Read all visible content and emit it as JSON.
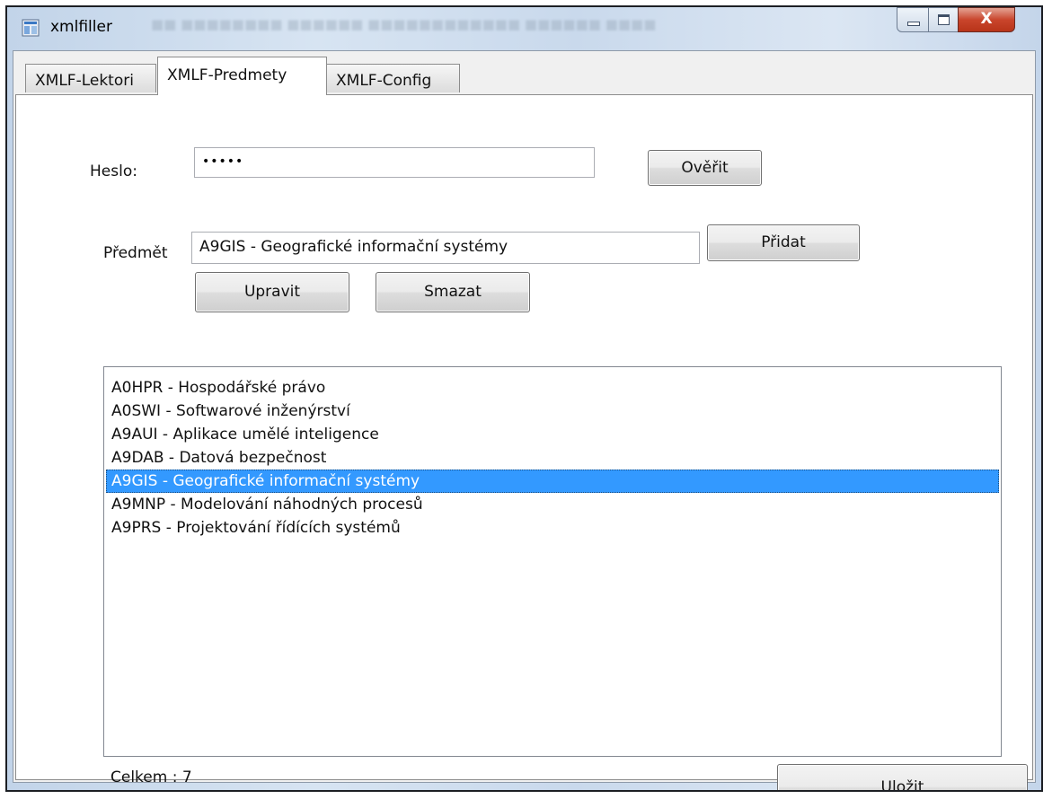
{
  "window": {
    "title": "xmlfiller",
    "background_colors": [
      "#c2d4e9",
      "#dbe6f3"
    ]
  },
  "title_controls": {
    "minimize_icon": "minimize-icon",
    "maximize_icon": "maximize-icon",
    "close_glyph": "X"
  },
  "tabs": [
    {
      "label": "XMLF-Lektori",
      "active": false
    },
    {
      "label": "XMLF-Predmety",
      "active": true
    },
    {
      "label": "XMLF-Config",
      "active": false
    }
  ],
  "form": {
    "password_label": "Heslo:",
    "password_value": "•••••",
    "verify_button": "Ověřit",
    "subject_label": "Předmět",
    "subject_value": "A9GIS - Geografické informační systémy",
    "add_button": "Přidat",
    "edit_button": "Upravit",
    "delete_button": "Smazat"
  },
  "subjects": {
    "items": [
      "A0HPR - Hospodářské právo",
      "A0SWI - Softwarové inženýrství",
      "A9AUI - Aplikace umělé inteligence",
      "A9DAB - Datová bezpečnost",
      "A9GIS - Geografické informační systémy",
      "A9MNP - Modelování náhodných procesů",
      "A9PRS - Projektování řídících systémů"
    ],
    "selected_index": 4,
    "selection_color": "#3399ff"
  },
  "footer": {
    "count_label": "Celkem : 7",
    "save_button": "Uložit"
  }
}
